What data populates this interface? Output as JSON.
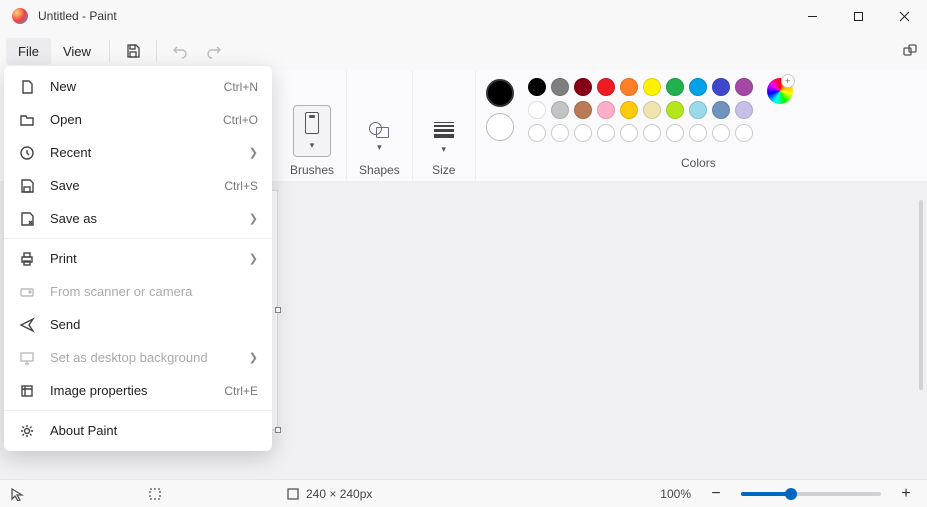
{
  "title": "Untitled - Paint",
  "menubar": {
    "file": "File",
    "view": "View"
  },
  "ribbon": {
    "brushes": "Brushes",
    "shapes": "Shapes",
    "size": "Size",
    "colors": "Colors"
  },
  "colors": {
    "fg": "#000000",
    "bg": "#ffffff",
    "row1": [
      "#000000",
      "#7f7f7f",
      "#880015",
      "#ed1c24",
      "#ff7f27",
      "#fff200",
      "#22b14c",
      "#00a2e8",
      "#3f48cc",
      "#a349a4"
    ],
    "row2": [
      "#ffffff",
      "#c3c3c3",
      "#b97a57",
      "#ffaec9",
      "#ffc90e",
      "#efe4b0",
      "#b5e61d",
      "#99d9ea",
      "#7092be",
      "#c8bfe7"
    ]
  },
  "filemenu": [
    {
      "icon": "file",
      "label": "New",
      "shortcut": "Ctrl+N"
    },
    {
      "icon": "folder",
      "label": "Open",
      "shortcut": "Ctrl+O"
    },
    {
      "icon": "clock",
      "label": "Recent",
      "arrow": true
    },
    {
      "icon": "save",
      "label": "Save",
      "shortcut": "Ctrl+S"
    },
    {
      "icon": "saveas",
      "label": "Save as",
      "arrow": true
    },
    {
      "sep": true
    },
    {
      "icon": "print",
      "label": "Print",
      "arrow": true
    },
    {
      "icon": "scanner",
      "label": "From scanner or camera",
      "disabled": true
    },
    {
      "icon": "send",
      "label": "Send"
    },
    {
      "icon": "desktop",
      "label": "Set as desktop background",
      "arrow": true,
      "disabled": true
    },
    {
      "icon": "props",
      "label": "Image properties",
      "shortcut": "Ctrl+E"
    },
    {
      "sep": true
    },
    {
      "icon": "gear",
      "label": "About Paint"
    }
  ],
  "status": {
    "size": "240 × 240px",
    "zoom": "100%"
  }
}
